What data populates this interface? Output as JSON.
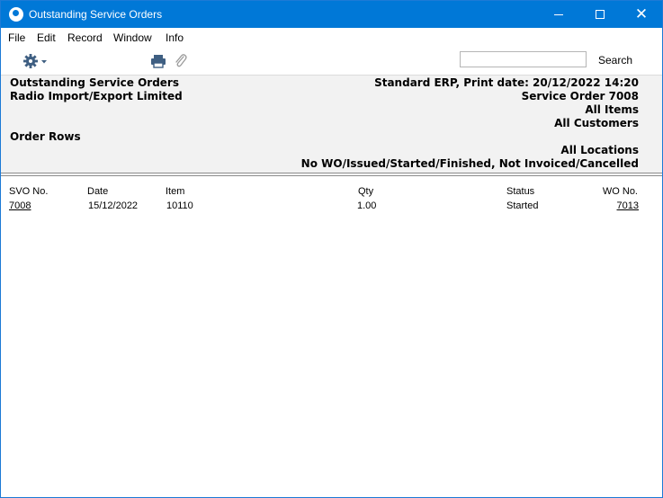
{
  "window": {
    "title": "Outstanding Service Orders"
  },
  "menu": [
    "File",
    "Edit",
    "Record",
    "Window",
    "Info"
  ],
  "toolbar": {
    "search_label": "Search",
    "search_value": ""
  },
  "report": {
    "left": [
      "Outstanding Service Orders",
      "Radio Import/Export Limited",
      "Order Rows"
    ],
    "right": [
      "Standard ERP, Print date: 20/12/2022 14:20",
      "Service Order 7008",
      "All Items",
      "All Customers",
      "All Locations",
      "No WO/Issued/Started/Finished, Not Invoiced/Cancelled"
    ]
  },
  "table": {
    "columns": [
      "SVO No.",
      "Date",
      "Item",
      "Qty",
      "Status",
      "WO No."
    ],
    "rows": [
      {
        "svo_no": "7008",
        "date": "15/12/2022",
        "item": "10110",
        "qty": "1.00",
        "status": "Started",
        "wo_no": "7013"
      }
    ]
  }
}
